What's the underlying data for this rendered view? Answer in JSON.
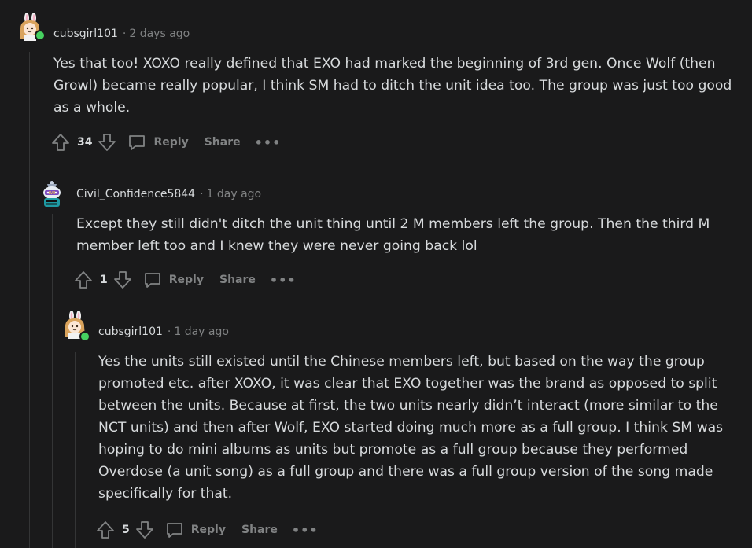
{
  "comments": [
    {
      "author": "cubsgirl101",
      "time": "2 days ago",
      "body": "Yes that too! XOXO really defined that EXO had marked the beginning of 3rd gen. Once Wolf (then Growl) became really popular, I think SM had to ditch the unit idea too. The group was just too good as a whole.",
      "votes": "34",
      "reply_label": "Reply",
      "share_label": "Share",
      "more_label": "•••"
    },
    {
      "author": "Civil_Confidence5844",
      "time": "1 day ago",
      "body": "Except they still didn't ditch the unit thing until 2 M members left the group. Then the third M member left too and I knew they were never going back lol",
      "votes": "1",
      "reply_label": "Reply",
      "share_label": "Share",
      "more_label": "•••"
    },
    {
      "author": "cubsgirl101",
      "time": "1 day ago",
      "body": "Yes the units still existed until the Chinese members left, but based on the way the group promoted etc. after XOXO, it was clear that EXO together was the brand as opposed to split between the units. Because at first, the two units nearly didn’t interact (more similar to the NCT units) and then after Wolf, EXO started doing much more as a full group. I think SM was hoping to do mini albums as units but promote as a full group because they performed Overdose (a unit song) as a full group and there was a full group version of the song made specifically for that.",
      "votes": "5",
      "reply_label": "Reply",
      "share_label": "Share",
      "more_label": "•••"
    }
  ],
  "colors": {
    "background": "#1a1a1b",
    "text": "#d7dadc",
    "muted": "#818384",
    "online": "#46d160"
  }
}
